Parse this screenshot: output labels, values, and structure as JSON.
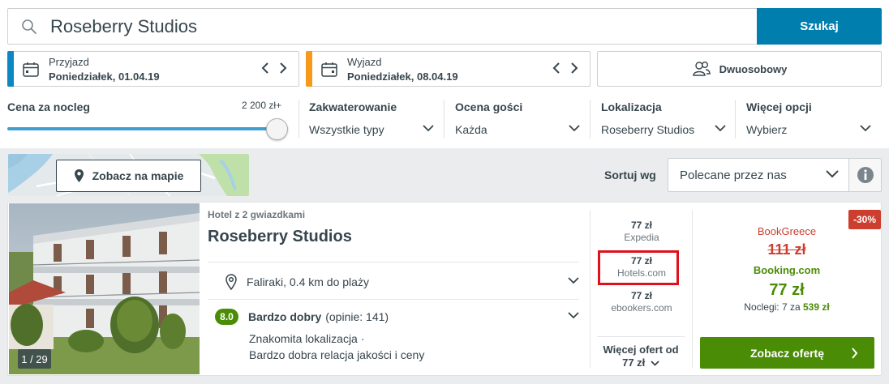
{
  "search": {
    "value": "Roseberry Studios",
    "button_label": "Szukaj"
  },
  "checkin": {
    "label": "Przyjazd",
    "value": "Poniedziałek, 01.04.19",
    "accent": "#0d86c4"
  },
  "checkout": {
    "label": "Wyjazd",
    "value": "Poniedziałek, 08.04.19",
    "accent": "#f79a1b"
  },
  "guests": {
    "label": "Dwuosobowy",
    "icon": "users-icon"
  },
  "filters": {
    "price": {
      "title": "Cena za nocleg",
      "max_label": "2 200 zł+",
      "level_fraction": 1.0
    },
    "accommodation": {
      "title": "Zakwaterowanie",
      "value": "Wszystkie typy"
    },
    "rating": {
      "title": "Ocena gości",
      "value": "Każda"
    },
    "location": {
      "title": "Lokalizacja",
      "value": "Roseberry Studios"
    },
    "more": {
      "title": "Więcej opcji",
      "value": "Wybierz"
    }
  },
  "map": {
    "button_label": "Zobacz na mapie"
  },
  "sort": {
    "label": "Sortuj wg",
    "value": "Polecane przez nas"
  },
  "hotel": {
    "type": "Hotel z 2 gwiazdkami",
    "name": "Roseberry Studios",
    "photo_counter": "1 / 29",
    "location": "Faliraki, 0.4 km do plaży",
    "rating_score": "8.0",
    "rating_word": "Bardzo dobry",
    "rating_count": "(opinie: 141)",
    "review_line1": "Znakomita lokalizacja ·",
    "review_line2": "Bardzo dobra relacja jakości i ceny"
  },
  "offers": [
    {
      "price": "77 zł",
      "site": "Expedia"
    },
    {
      "price": "77 zł",
      "site": "Hotels.com",
      "highlighted": true
    },
    {
      "price": "77 zł",
      "site": "ebookers.com"
    }
  ],
  "more_offers": {
    "label": "Więcej ofert od",
    "price": "77 zł"
  },
  "deal": {
    "discount": "-30%",
    "compare_site": "BookGreece",
    "old_price": "111 zł",
    "best_site": "Booking.com",
    "price": "77 zł",
    "nights_prefix": "Noclegi: 7 za",
    "nights_total": "539 zł",
    "button_label": "Zobacz ofertę"
  },
  "colors": {
    "primary": "#007faf",
    "deal_green": "#4a8c06",
    "deal_red": "#cc3e2e",
    "highlight": "#e0101c"
  }
}
